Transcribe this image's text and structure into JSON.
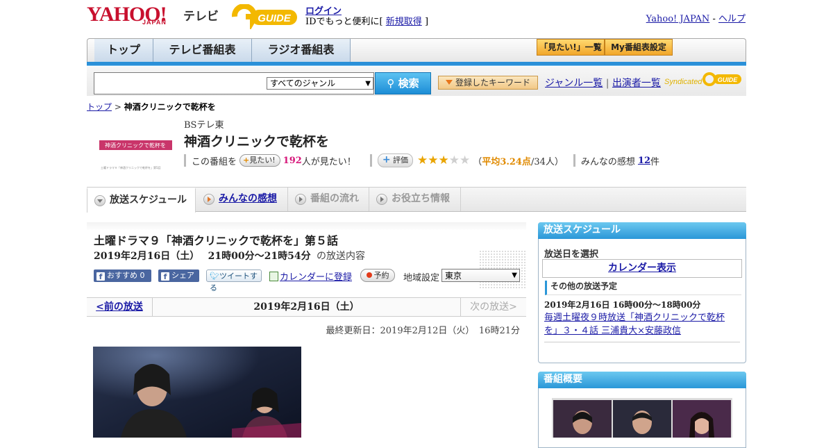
{
  "header": {
    "logo_yahoo": "YAHOO!",
    "logo_japan": "JAPAN",
    "logo_tv": "テレビ",
    "logo_guide": "GUIDE",
    "login": "ログイン",
    "login_sub_prefix": "IDでもっと便利に[",
    "signup": "新規取得",
    "login_sub_suffix": "]",
    "yahoo_japan": "Yahoo! JAPAN",
    "sep": "-",
    "help": "ヘルプ"
  },
  "nav": {
    "tabs": [
      "トップ",
      "テレビ番組表",
      "ラジオ番組表"
    ],
    "mitai_list": "「見たい!」一覧",
    "my_schedule": "My番組表設定"
  },
  "search": {
    "genre": "すべてのジャンル",
    "button": "検索",
    "keyword_btn": "登録したキーワード",
    "genre_list": "ジャンル一覧",
    "pipe": "|",
    "performer_list": "出演者一覧",
    "syndicated": "Syndicated",
    "mini_guide": "GUIDE"
  },
  "breadcrumb": {
    "home": "トップ",
    "sep": ">",
    "current": "神酒クリニックで乾杯を"
  },
  "program": {
    "thumb_text": "神酒クリニックで乾杯を",
    "thumb_small": "土曜ドラマ９「神酒クリニックで乾杯を」第5話",
    "channel": "BSテレ東",
    "title": "神酒クリニックで乾杯を",
    "mitai_prefix": "この番組を",
    "mitai_btn": "見たい!",
    "mitai_count": "192",
    "mitai_suffix": "人が見たい！",
    "eval_btn": "評価",
    "rating_stars": 3,
    "rating_open": "（",
    "rating_avg": "平均3.24点",
    "rating_people": "/34人）",
    "impressions_label": "みんなの感想",
    "impressions_count": "12",
    "impressions_unit": "件"
  },
  "tabs": {
    "schedule": "放送スケジュール",
    "impressions": "みんなの感想",
    "flow": "番組の流れ",
    "info": "お役立ち情報"
  },
  "episode": {
    "title": "土曜ドラマ９「神酒クリニックで乾杯を」第５話",
    "date": "2019年2月16日（土）",
    "time": "21時00分～21時54分",
    "content_label": "の放送内容",
    "fb_recommend": "おすすめ 0",
    "fb_share": "シェア",
    "tweet": "ツイートする",
    "calendar": "カレンダーに登録",
    "reserve": "予約",
    "region_label": "地域設定",
    "region_value": "東京"
  },
  "date_nav": {
    "prev": "<前の放送",
    "current": "2019年2月16日（土）",
    "next": "次の放送>"
  },
  "updated": "最終更新日：2019年2月12日（火）　16時21分",
  "sidebar": {
    "schedule_title": "放送スケジュール",
    "select_date": "放送日を選択",
    "calendar_btn": "カレンダー表示",
    "other_label": "その他の放送予定",
    "other_time": "2019年2月16日 16時00分～18時00分",
    "other_link": "毎週土曜夜９時放送「神酒クリニックで乾杯を」３・４話 三浦貴大×安藤政信",
    "overview_title": "番組概要"
  }
}
